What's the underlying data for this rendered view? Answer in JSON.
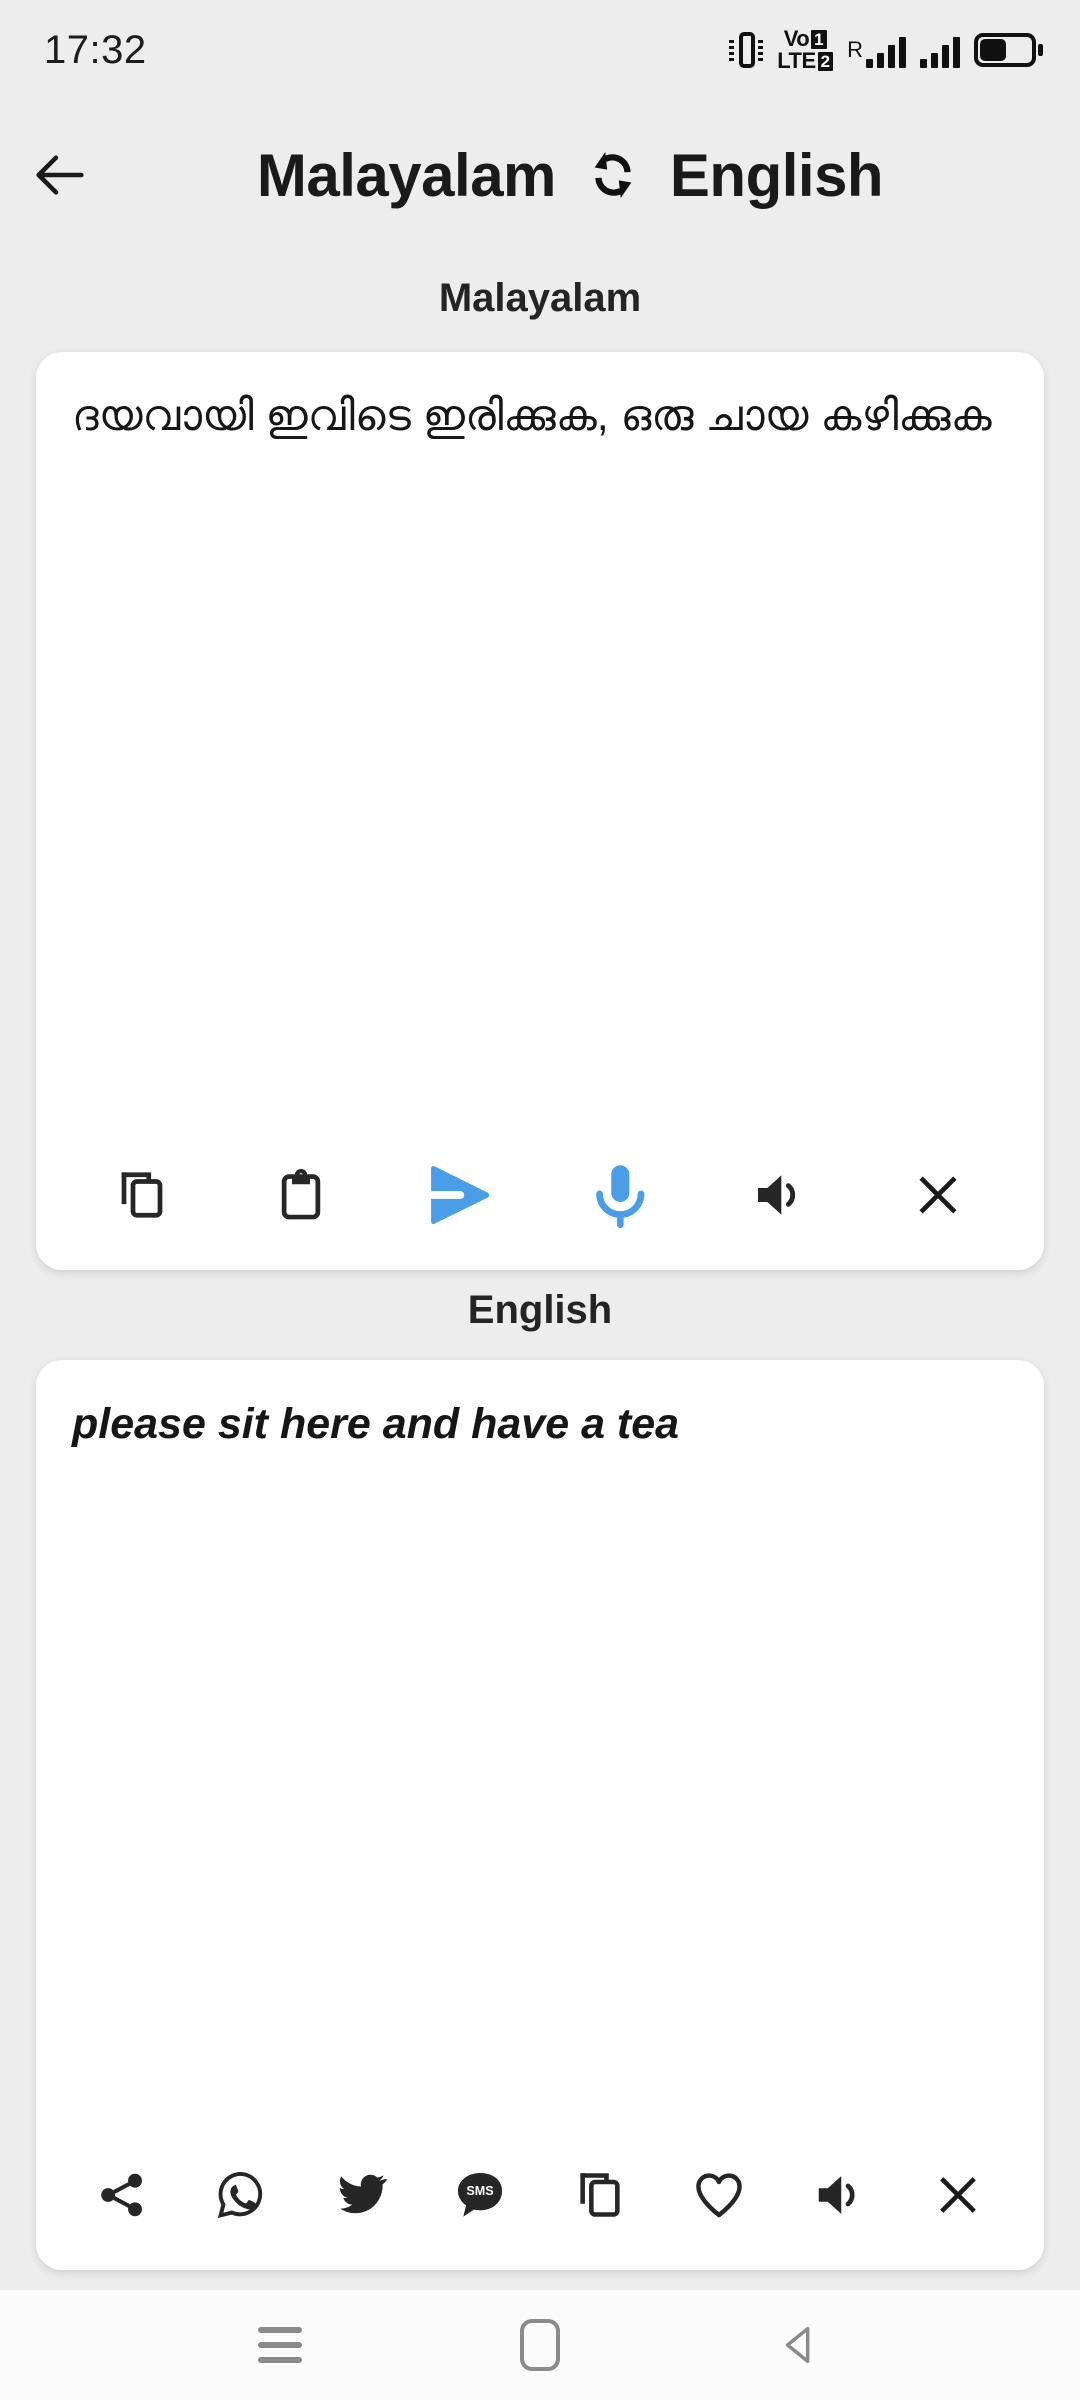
{
  "status_bar": {
    "time": "17:32",
    "icons": {
      "vibrate": "vibrate-icon",
      "volte_label_top": "VoLTE",
      "volte_text_line1": "Vo",
      "volte_text_line2": "LTE",
      "sim1_badge": "1",
      "sim2_badge": "2",
      "roaming": "R",
      "battery": "battery-icon"
    }
  },
  "header": {
    "back_icon": "back-arrow-icon",
    "source_language": "Malayalam",
    "swap_icon": "swap-languages-icon",
    "target_language": "English"
  },
  "source_section": {
    "label": "Malayalam",
    "text": "ദയവായി ഇവിടെ ഇരിക്കുക, ഒരു ചായ കഴിക്കുക",
    "toolbar": [
      {
        "name": "copy-icon",
        "label": "Copy"
      },
      {
        "name": "paste-icon",
        "label": "Paste"
      },
      {
        "name": "translate-send-icon",
        "label": "Translate"
      },
      {
        "name": "microphone-icon",
        "label": "Voice input"
      },
      {
        "name": "speaker-icon",
        "label": "Speak"
      },
      {
        "name": "clear-icon",
        "label": "Clear"
      }
    ]
  },
  "target_section": {
    "label": "English",
    "text": "please sit here and have a tea",
    "toolbar": [
      {
        "name": "share-icon",
        "label": "Share"
      },
      {
        "name": "whatsapp-icon",
        "label": "WhatsApp"
      },
      {
        "name": "twitter-icon",
        "label": "Twitter"
      },
      {
        "name": "sms-icon",
        "label": "SMS"
      },
      {
        "name": "copy-icon",
        "label": "Copy"
      },
      {
        "name": "favorite-icon",
        "label": "Favorite"
      },
      {
        "name": "speaker-icon",
        "label": "Speak"
      },
      {
        "name": "clear-icon",
        "label": "Clear"
      }
    ]
  },
  "nav_bar": {
    "recents": "recents-icon",
    "home": "home-icon",
    "back": "back-icon"
  },
  "colors": {
    "background": "#ededed",
    "card": "#ffffff",
    "accent_blue": "#4a9ee8",
    "icon_dark": "#262626",
    "nav_gray": "#8a8a8a"
  },
  "sms_badge_text": "SMS"
}
